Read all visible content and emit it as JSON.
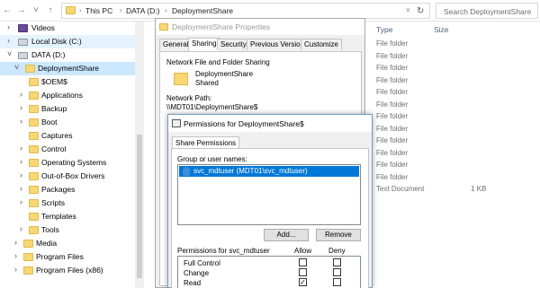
{
  "address": {
    "crumbs": [
      "This PC",
      "DATA (D:)",
      "DeploymentShare"
    ],
    "search_placeholder": "Search DeploymentShare"
  },
  "nav": {
    "items": [
      {
        "label": "Videos",
        "icon": "video-folder-icon"
      },
      {
        "label": "Local Disk (C:)",
        "icon": "drive-icon"
      },
      {
        "label": "DATA (D:)",
        "icon": "drive-icon"
      },
      {
        "label": "DeploymentShare",
        "icon": "folder-icon"
      },
      {
        "label": "$OEM$",
        "icon": "folder-icon"
      },
      {
        "label": "Applications",
        "icon": "folder-icon"
      },
      {
        "label": "Backup",
        "icon": "folder-icon"
      },
      {
        "label": "Boot",
        "icon": "folder-icon"
      },
      {
        "label": "Captures",
        "icon": "folder-icon"
      },
      {
        "label": "Control",
        "icon": "folder-icon"
      },
      {
        "label": "Operating Systems",
        "icon": "folder-icon"
      },
      {
        "label": "Out-of-Box Drivers",
        "icon": "folder-icon"
      },
      {
        "label": "Packages",
        "icon": "folder-icon"
      },
      {
        "label": "Scripts",
        "icon": "folder-icon"
      },
      {
        "label": "Templates",
        "icon": "folder-icon"
      },
      {
        "label": "Tools",
        "icon": "folder-icon"
      },
      {
        "label": "Media",
        "icon": "folder-icon"
      },
      {
        "label": "Program Files",
        "icon": "folder-icon"
      },
      {
        "label": "Program Files (x86)",
        "icon": "folder-icon"
      }
    ]
  },
  "filelist": {
    "col_type": "Type",
    "col_size": "Size",
    "rows": [
      {
        "type": "File folder",
        "size": ""
      },
      {
        "type": "File folder",
        "size": ""
      },
      {
        "type": "File folder",
        "size": ""
      },
      {
        "type": "File folder",
        "size": ""
      },
      {
        "type": "File folder",
        "size": ""
      },
      {
        "type": "File folder",
        "size": ""
      },
      {
        "type": "File folder",
        "size": ""
      },
      {
        "type": "File folder",
        "size": ""
      },
      {
        "type": "File folder",
        "size": ""
      },
      {
        "type": "File folder",
        "size": ""
      },
      {
        "type": "File folder",
        "size": ""
      },
      {
        "type": "File folder",
        "size": ""
      },
      {
        "type": "Text Document",
        "size": "1 KB"
      }
    ]
  },
  "properties": {
    "title": "DeploymentShare Properties",
    "tabs": [
      "General",
      "Sharing",
      "Security",
      "Previous Versions",
      "Customize"
    ],
    "group_title": "Network File and Folder Sharing",
    "share_name": "DeploymentShare",
    "share_status": "Shared",
    "network_path_label": "Network Path:",
    "network_path": "\\\\MDT01\\DeploymentShare$"
  },
  "permissions": {
    "title": "Permissions for DeploymentShare$",
    "tab": "Share Permissions",
    "group_label": "Group or user names:",
    "users": [
      "svc_mdtuser (MDT01\\svc_mdtuser)"
    ],
    "add_label": "Add...",
    "remove_label": "Remove",
    "perm_for_label": "Permissions for svc_mdtuser",
    "allow_label": "Allow",
    "deny_label": "Deny",
    "rows": [
      {
        "label": "Full Control",
        "allow": false,
        "deny": false
      },
      {
        "label": "Change",
        "allow": false,
        "deny": false
      },
      {
        "label": "Read",
        "allow": true,
        "deny": false
      }
    ]
  }
}
